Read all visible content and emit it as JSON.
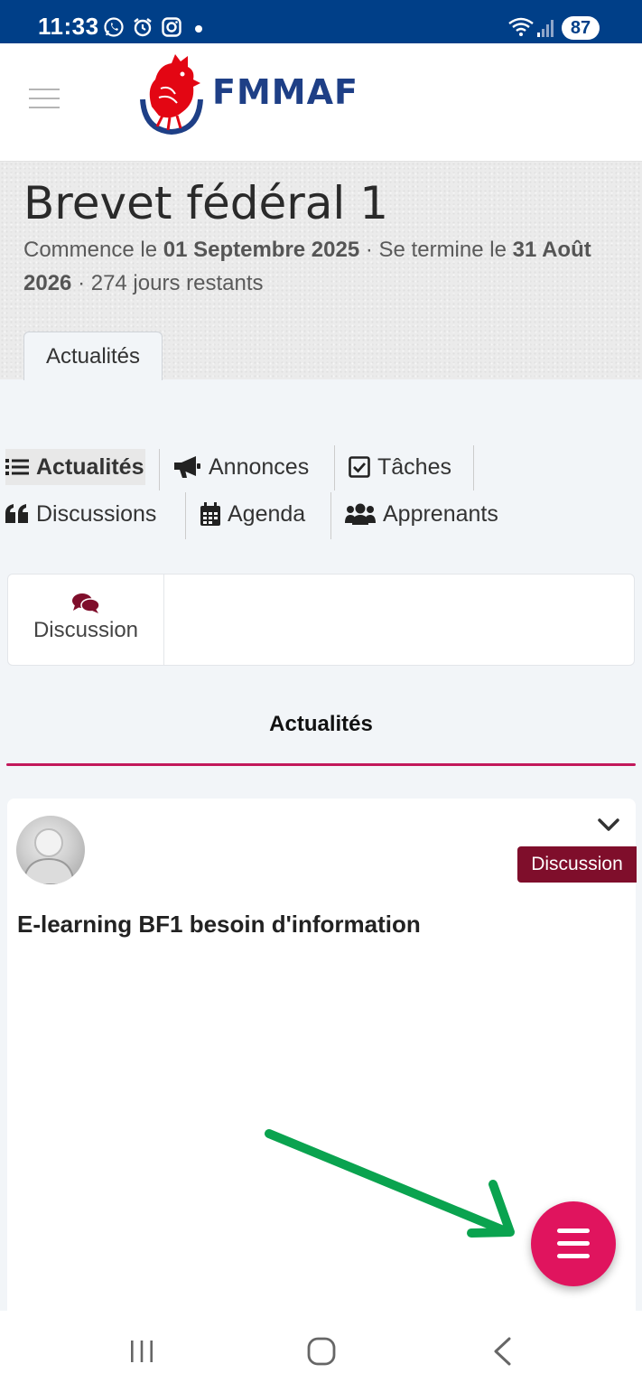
{
  "status_bar": {
    "time": "11:33",
    "battery": "87",
    "icons": [
      "whatsapp-icon",
      "alarm-icon",
      "instagram-icon",
      "notification-dot",
      "wifi-icon",
      "signal-icon"
    ]
  },
  "header": {
    "menu_icon": "hamburger-menu-icon",
    "logo_icon": "rooster-logo-icon",
    "brand": "FMMAF",
    "colors": {
      "brand": "#1e3f86",
      "logo_red": "#e30613"
    }
  },
  "course": {
    "title": "Brevet fédéral 1",
    "starts_prefix": "Commence le",
    "start_date": "01 Septembre 2025",
    "ends_prefix": "· Se termine le",
    "end_date": "31 Août 2026",
    "remaining": "· 274 jours restants",
    "banner_tab": "Actualités"
  },
  "nav": {
    "items": [
      {
        "label": "Actualités",
        "icon": "list-icon",
        "active": true
      },
      {
        "label": "Annonces",
        "icon": "bullhorn-icon"
      },
      {
        "label": "Tâches",
        "icon": "checkbox-icon"
      },
      {
        "label": "Discussions",
        "icon": "quote-icon"
      },
      {
        "label": "Agenda",
        "icon": "calendar-icon"
      },
      {
        "label": "Apprenants",
        "icon": "users-icon"
      }
    ]
  },
  "discussion_button": {
    "label": "Discussion",
    "icon": "comments-icon",
    "color": "#7f0e2b"
  },
  "feed": {
    "title": "Actualités",
    "underline_color": "#c2185b",
    "posts": [
      {
        "badge": "Discussion",
        "title": "E-learning BF1 besoin d'information",
        "badge_color": "#7f0e2b"
      }
    ]
  },
  "fab": {
    "icon": "hamburger-menu-icon",
    "color": "#e0145e"
  },
  "annotation": {
    "arrow_color": "#0aa34f"
  },
  "system_nav": {
    "icons": [
      "recents-icon",
      "home-icon",
      "back-icon"
    ]
  }
}
